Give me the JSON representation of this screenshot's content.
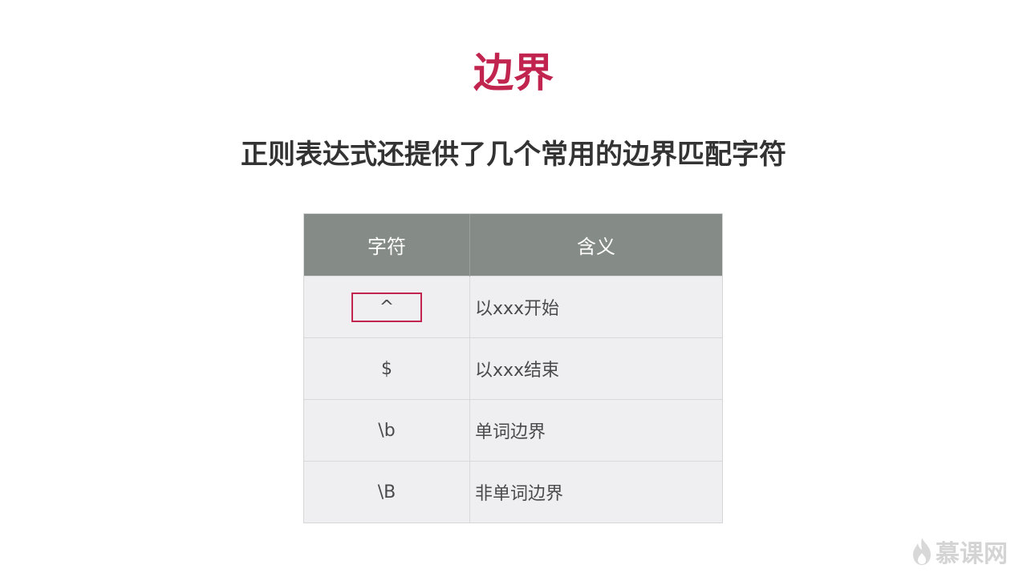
{
  "slide": {
    "title": "边界",
    "subtitle": "正则表达式还提供了几个常用的边界匹配字符"
  },
  "table": {
    "headers": [
      "字符",
      "含义"
    ],
    "rows": [
      {
        "char": "^",
        "meaning": "以xxx开始",
        "highlighted": true
      },
      {
        "char": "$",
        "meaning": "以xxx结束"
      },
      {
        "char": "\\b",
        "meaning": "单词边界"
      },
      {
        "char": "\\B",
        "meaning": "非单词边界"
      }
    ]
  },
  "watermark": {
    "text": "慕课网",
    "icon": "flame-logo-icon"
  },
  "colors": {
    "title": "#c0244f",
    "header_bg": "#858b87",
    "row_bg": "#efeff2",
    "highlight": "#c0244f"
  }
}
